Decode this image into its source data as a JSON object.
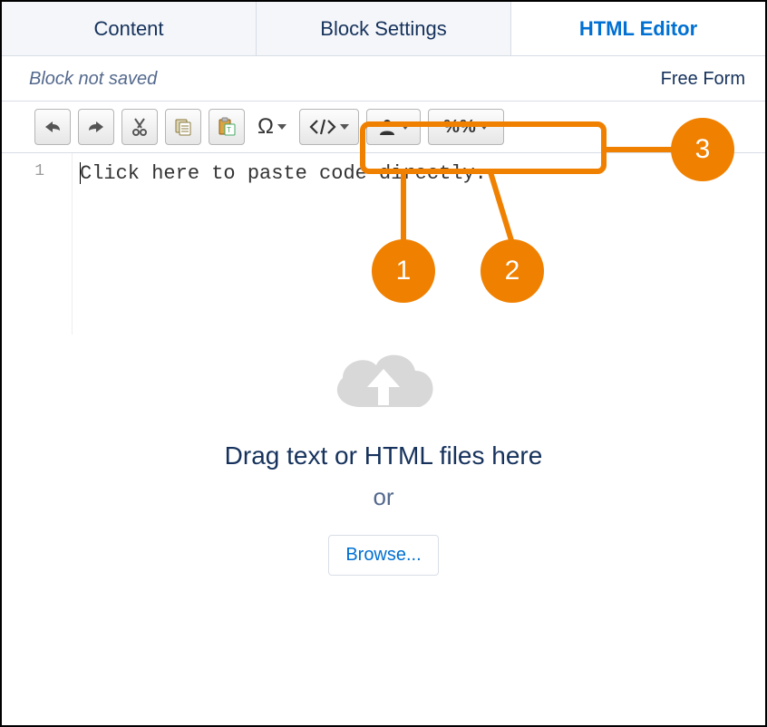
{
  "tabs": {
    "content": "Content",
    "block_settings": "Block Settings",
    "html_editor": "HTML Editor"
  },
  "status": {
    "not_saved": "Block not saved",
    "mode": "Free Form"
  },
  "toolbar": {
    "omega": "Ω",
    "percent": "%%"
  },
  "editor": {
    "line_number": "1",
    "placeholder": "Click here to paste code directly."
  },
  "dropzone": {
    "message": "Drag text or HTML files here",
    "or": "or",
    "browse": "Browse..."
  },
  "callouts": {
    "c1": "1",
    "c2": "2",
    "c3": "3"
  }
}
